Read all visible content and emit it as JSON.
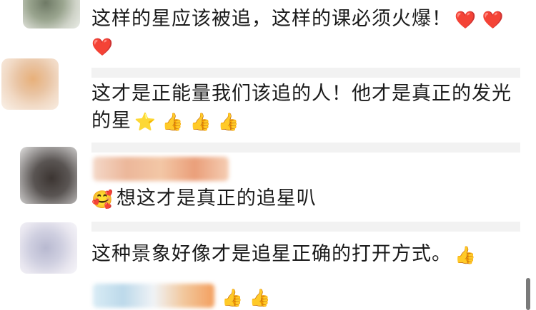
{
  "comments": [
    {
      "text": "这样的星应该被追，这样的课必须火爆！",
      "emojis": [
        "❤️",
        "❤️",
        "❤️"
      ]
    },
    {
      "text": "这才是正能量我们该追的人！他才是真正的发光的星",
      "emojis": [
        "⭐",
        "👍",
        "👍",
        "👍"
      ]
    },
    {
      "lead_emoji": "🥰",
      "text": "想这才是真正的追星叭"
    },
    {
      "text": "这种景象好像才是追星正确的打开方式。",
      "emojis": [
        "👍"
      ]
    },
    {
      "emojis": [
        "👍",
        "👍"
      ]
    }
  ]
}
